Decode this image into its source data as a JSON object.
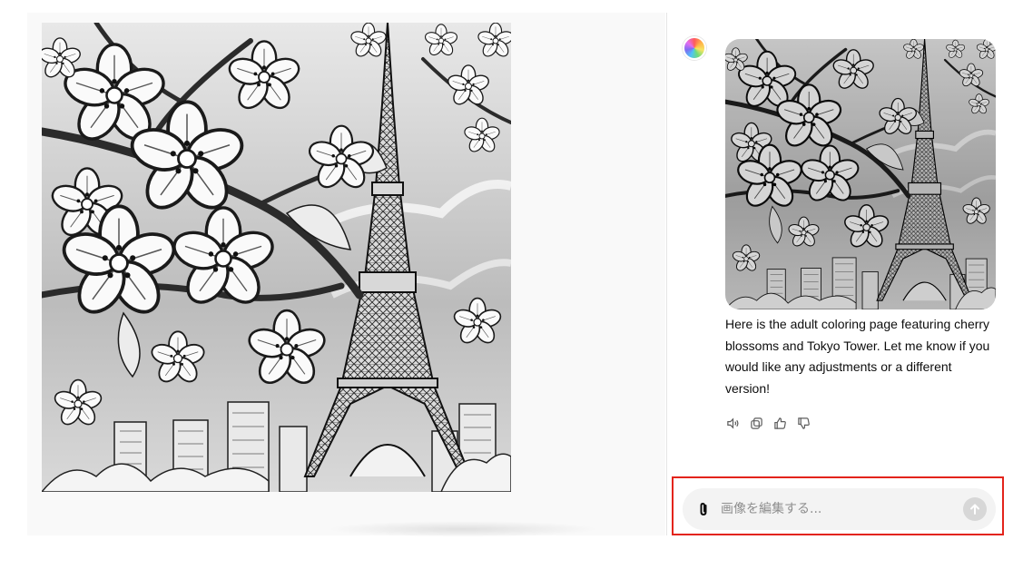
{
  "viewer": {
    "image_icon": "coloring-page-image"
  },
  "chat": {
    "avatar_icon": "assistant-avatar-icon",
    "message_text": "Here is the adult coloring page featuring cherry blossoms and Tokyo Tower. Let me know if you would like any adjustments or a different version!",
    "actions": [
      {
        "icon": "read-aloud-icon"
      },
      {
        "icon": "copy-icon"
      },
      {
        "icon": "thumbs-up-icon"
      },
      {
        "icon": "thumbs-down-icon"
      }
    ]
  },
  "composer": {
    "placeholder": "画像を編集する...",
    "attach_icon": "paperclip-icon",
    "send_icon": "arrow-up-icon"
  },
  "colors": {
    "highlight": "#e3241b",
    "composer_bg": "#f3f3f3",
    "send_disabled": "#d7d7d7"
  }
}
